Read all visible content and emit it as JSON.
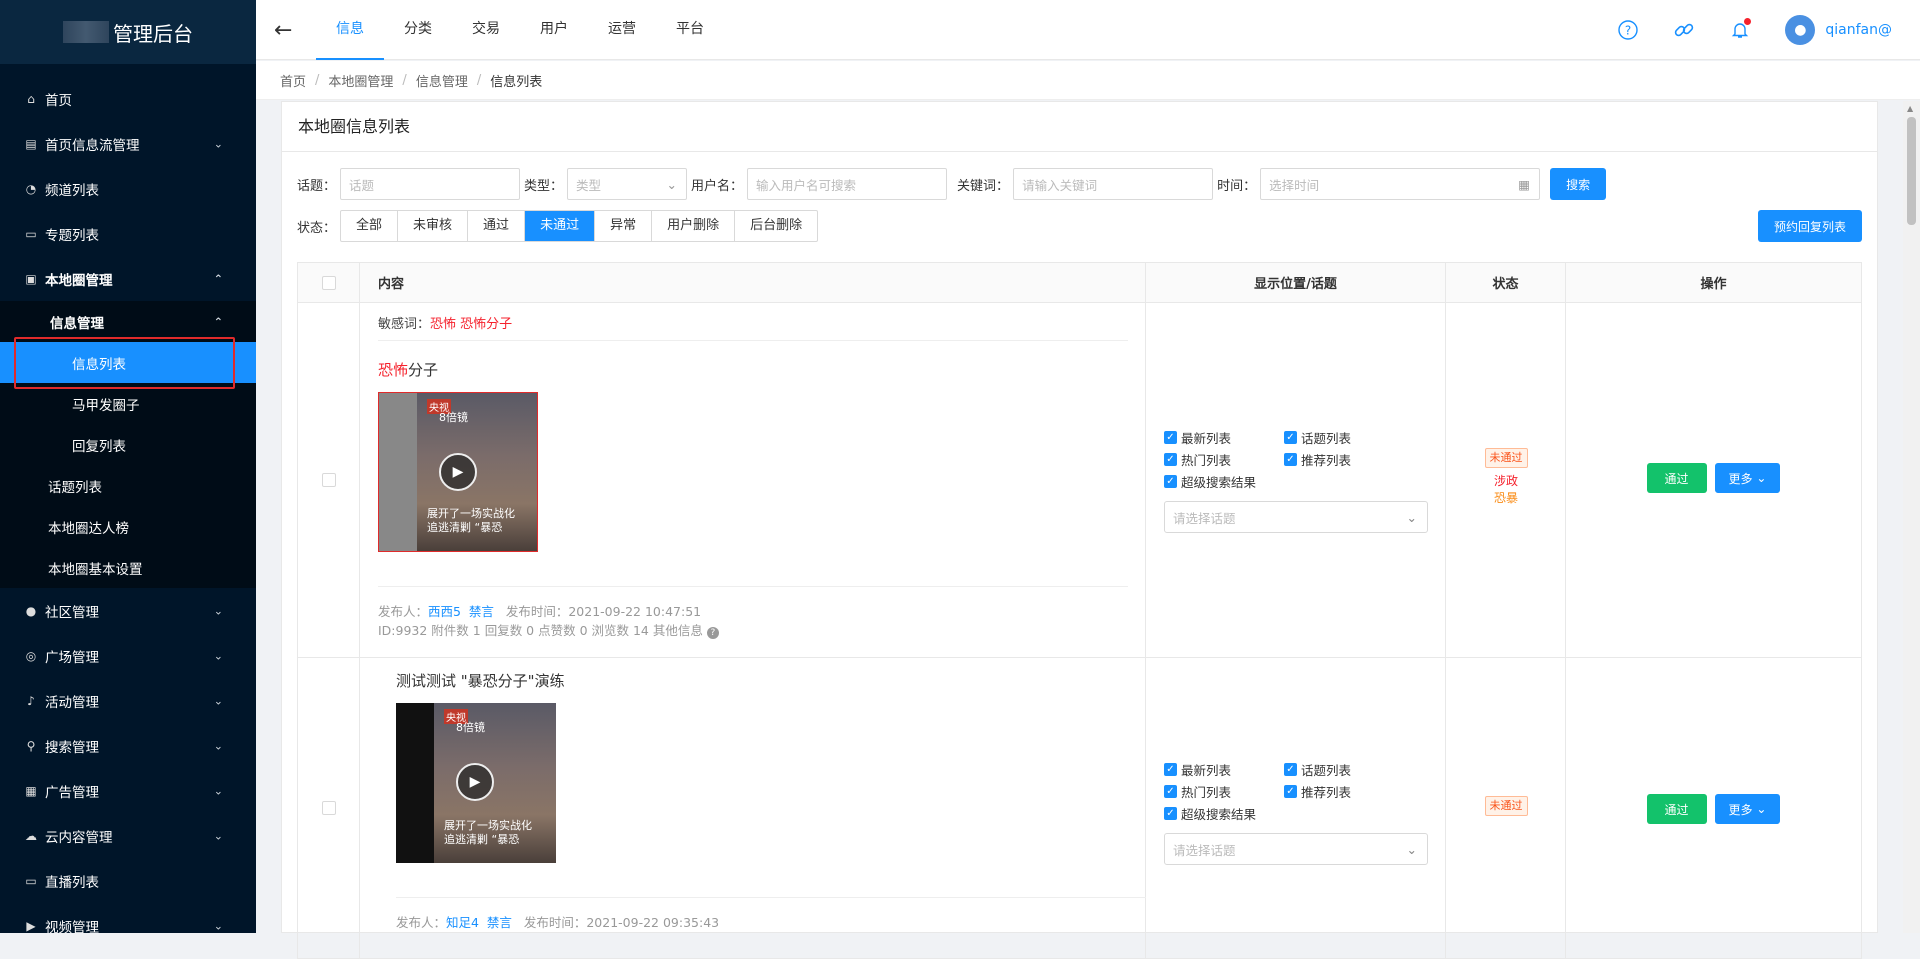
{
  "app": {
    "logo_text": "管理后台"
  },
  "sidebar": {
    "items": [
      {
        "label": "首页",
        "icon": "home-icon"
      },
      {
        "label": "首页信息流管理",
        "icon": "doc-icon",
        "arrow": "⌄"
      },
      {
        "label": "频道列表",
        "icon": "rss-icon"
      },
      {
        "label": "专题列表",
        "icon": "folder-icon"
      },
      {
        "label": "本地圈管理",
        "icon": "card-icon",
        "arrow": "⌃"
      }
    ],
    "local": {
      "info_mgmt": "信息管理",
      "info_list": "信息列表",
      "majia": "马甲发圈子",
      "reply": "回复列表",
      "topic": "话题列表",
      "daren": "本地圈达人榜",
      "settings": "本地圈基本设置"
    },
    "bottom": [
      {
        "label": "社区管理",
        "icon": "user-icon"
      },
      {
        "label": "广场管理",
        "icon": "compass-icon"
      },
      {
        "label": "活动管理",
        "icon": "bell-icon"
      },
      {
        "label": "搜索管理",
        "icon": "search-icon"
      },
      {
        "label": "广告管理",
        "icon": "ad-icon"
      },
      {
        "label": "云内容管理",
        "icon": "cloud-icon"
      },
      {
        "label": "直播列表",
        "icon": "tv-icon"
      },
      {
        "label": "视频管理",
        "icon": "video-icon"
      }
    ]
  },
  "topbar": {
    "tabs": [
      "信息",
      "分类",
      "交易",
      "用户",
      "运营",
      "平台"
    ],
    "active_tab": "信息",
    "username": "qianfan@"
  },
  "breadcrumb": [
    "首页",
    "本地圈管理",
    "信息管理",
    "信息列表"
  ],
  "page": {
    "title": "本地圈信息列表",
    "filters": {
      "topic_label": "话题：",
      "topic_placeholder": "话题",
      "type_label": "类型：",
      "type_placeholder": "类型",
      "user_label": "用户名：",
      "user_placeholder": "输入用户名可搜索",
      "keyword_label": "关键词：",
      "keyword_placeholder": "请输入关键词",
      "time_label": "时间：",
      "time_placeholder": "选择时间",
      "search_btn": "搜索"
    },
    "status_label": "状态：",
    "status_options": [
      "全部",
      "未审核",
      "通过",
      "未通过",
      "异常",
      "用户删除",
      "后台删除"
    ],
    "status_active": "未通过",
    "reserve_btn": "预约回复列表"
  },
  "table": {
    "headers": {
      "content": "内容",
      "position": "显示位置/话题",
      "status": "状态",
      "ops": "操作"
    },
    "rows": [
      {
        "sensitive_label": "敏感词：",
        "sensitive_words": "恐怖  恐怖分子",
        "title_red": "恐怖",
        "title_rest": "分子",
        "video_tag": "央视",
        "video_brand": "8倍镜",
        "video_text1": "展开了一场实战化",
        "video_text2": "追逃清剿 “暴恐",
        "publisher_label": "发布人：",
        "publisher": "西西5",
        "ban": "禁言",
        "time": "发布时间：2021-09-22 10:47:51",
        "stats": "ID:9932 附件数 1 回复数 0 点赞数 0 浏览数 14  其他信息",
        "checks": [
          "最新列表",
          "话题列表",
          "热门列表",
          "推荐列表",
          "超级搜索结果"
        ],
        "select_placeholder": "请选择话题",
        "status_tag": "未通过",
        "reason1": "涉政",
        "reason2": "恐暴",
        "pass_btn": "通过",
        "more_btn": "更多"
      },
      {
        "title": "测试测试 \"暴恐分子\"演练",
        "video_tag": "央视",
        "video_brand": "8倍镜",
        "video_text1": "展开了一场实战化",
        "video_text2": "追逃清剿 “暴恐",
        "publisher_label": "发布人：",
        "publisher": "知足4",
        "ban": "禁言",
        "time": "发布时间：2021-09-22 09:35:43",
        "checks": [
          "最新列表",
          "话题列表",
          "热门列表",
          "推荐列表",
          "超级搜索结果"
        ],
        "select_placeholder": "请选择话题",
        "status_tag": "未通过",
        "pass_btn": "通过",
        "more_btn": "更多"
      }
    ]
  },
  "colors": {
    "primary": "#1890ff",
    "sidebar": "#001529",
    "danger": "#f5222d",
    "success": "#13c26b",
    "warning": "#fa8c16"
  }
}
